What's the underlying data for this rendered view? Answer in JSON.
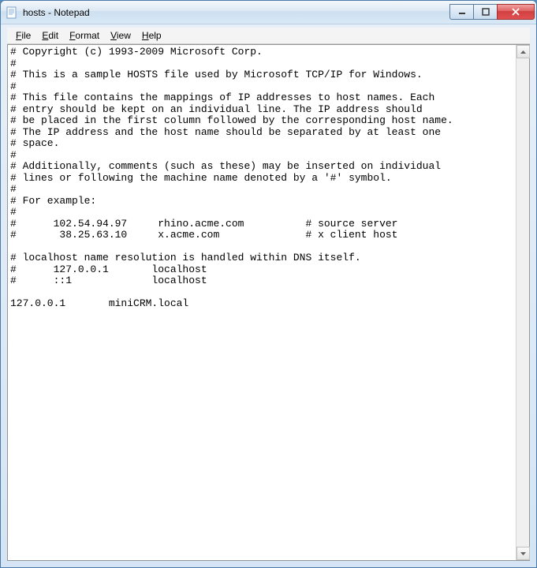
{
  "titlebar": {
    "title": "hosts - Notepad"
  },
  "menubar": {
    "file": "File",
    "edit": "Edit",
    "format": "Format",
    "view": "View",
    "help": "Help"
  },
  "editor": {
    "content": "# Copyright (c) 1993-2009 Microsoft Corp.\n#\n# This is a sample HOSTS file used by Microsoft TCP/IP for Windows.\n#\n# This file contains the mappings of IP addresses to host names. Each\n# entry should be kept on an individual line. The IP address should\n# be placed in the first column followed by the corresponding host name.\n# The IP address and the host name should be separated by at least one\n# space.\n#\n# Additionally, comments (such as these) may be inserted on individual\n# lines or following the machine name denoted by a '#' symbol.\n#\n# For example:\n#\n#      102.54.94.97     rhino.acme.com          # source server\n#       38.25.63.10     x.acme.com              # x client host\n\n# localhost name resolution is handled within DNS itself.\n#      127.0.0.1       localhost\n#      ::1             localhost\n\n127.0.0.1       miniCRM.local\n"
  }
}
